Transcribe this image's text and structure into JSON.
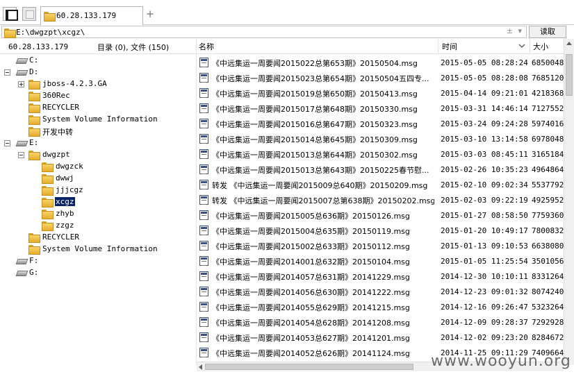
{
  "tab": {
    "label": "60.28.133.179"
  },
  "address": {
    "path": "E:\\dwgzpt\\xcgz\\",
    "arrows": "± ▾",
    "read_label": "读取"
  },
  "header": {
    "server_ip": "60.28.133.179",
    "counts": "目录 (0), 文件 (150)",
    "col_name": "名称",
    "col_time": "时间",
    "col_size": "大小"
  },
  "tree": [
    {
      "label": "C:",
      "type": "drive"
    },
    {
      "label": "D:",
      "type": "drive"
    },
    {
      "label": "jboss-4.2.3.GA",
      "type": "folder"
    },
    {
      "label": "360Rec",
      "type": "folder"
    },
    {
      "label": "RECYCLER",
      "type": "folder"
    },
    {
      "label": "System Volume Information",
      "type": "folder"
    },
    {
      "label": "开发中转",
      "type": "folder"
    },
    {
      "label": "E:",
      "type": "drive"
    },
    {
      "label": "dwgzpt",
      "type": "folder"
    },
    {
      "label": "dwgzck",
      "type": "folder"
    },
    {
      "label": "dwwj",
      "type": "folder"
    },
    {
      "label": "jjjcgz",
      "type": "folder"
    },
    {
      "label": "xcgz",
      "type": "folder"
    },
    {
      "label": "zhyb",
      "type": "folder"
    },
    {
      "label": "zzgz",
      "type": "folder"
    },
    {
      "label": "RECYCLER",
      "type": "folder"
    },
    {
      "label": "System Volume Information",
      "type": "folder"
    },
    {
      "label": "F:",
      "type": "drive"
    },
    {
      "label": "G:",
      "type": "drive"
    }
  ],
  "files": [
    {
      "name": "《中远集运一周要闻2015022总第653期》20150504.msg",
      "time": "2015-05-05 08:28:24",
      "size": "6850048"
    },
    {
      "name": "《中远集运一周要闻2015023总第654期》20150504五四专...",
      "time": "2015-05-05 08:28:08",
      "size": "7685120"
    },
    {
      "name": "《中远集运一周要闻2015019总第650期》20150413.msg",
      "time": "2015-04-14 09:21:01",
      "size": "4218368"
    },
    {
      "name": "《中远集运一周要闻2015017总第648期》20150330.msg",
      "time": "2015-03-31 14:46:14",
      "size": "7127552"
    },
    {
      "name": "《中远集运一周要闻2015016总第647期》20150323.msg",
      "time": "2015-03-24 09:24:28",
      "size": "5974016"
    },
    {
      "name": "《中远集运一周要闻2015014总第645期》20150309.msg",
      "time": "2015-03-10 13:14:58",
      "size": "6978048"
    },
    {
      "name": "《中远集运一周要闻2015013总第644期》20150302.msg",
      "time": "2015-03-03 08:45:11",
      "size": "3165184"
    },
    {
      "name": "《中远集运一周要闻2015013总第643期》20150225春节慰...",
      "time": "2015-02-26 10:35:23",
      "size": "4964864"
    },
    {
      "name": "转发 《中远集运一周要闻2015009总640期》20150209.msg",
      "time": "2015-02-10 09:02:34",
      "size": "5537792"
    },
    {
      "name": "转发 《中远集运一周要闻2015007总第638期》20150202.msg",
      "time": "2015-02-03 09:22:19",
      "size": "4925952"
    },
    {
      "name": "《中远集运一周要闻2015005总636期》20150126.msg",
      "time": "2015-01-27 08:58:50",
      "size": "7759360"
    },
    {
      "name": "《中远集运一周要闻2015004总635期》20150119.msg",
      "time": "2015-01-20 10:49:17",
      "size": "7800832"
    },
    {
      "name": "《中远集运一周要闻2015002总633期》20150112.msg",
      "time": "2015-01-13 09:10:53",
      "size": "6638080"
    },
    {
      "name": "《中远集运一周要闻2014001总632期》20150104.msg",
      "time": "2015-01-05 11:25:54",
      "size": "3501056"
    },
    {
      "name": "《中远集运一周要闻2014057总631期》20141229.msg",
      "time": "2014-12-30 10:10:11",
      "size": "8331264"
    },
    {
      "name": "《中远集运一周要闻2014056总630期》20141222.msg",
      "time": "2014-12-23 09:01:32",
      "size": "8074240"
    },
    {
      "name": "《中远集运一周要闻2014055总629期》20141215.msg",
      "time": "2014-12-16 09:26:47",
      "size": "5323264"
    },
    {
      "name": "《中远集运一周要闻2014054总628期》20141208.msg",
      "time": "2014-12-09 09:28:37",
      "size": "7292928"
    },
    {
      "name": "《中远集运一周要闻2014053总627期》20141201.msg",
      "time": "2014-12-02 09:23:20",
      "size": "8284672"
    },
    {
      "name": "《中远集运一周要闻2014052总626期》20141124.msg",
      "time": "2014-11-25 09:11:29",
      "size": "7409664"
    }
  ],
  "watermark": "www.wooyun.org"
}
